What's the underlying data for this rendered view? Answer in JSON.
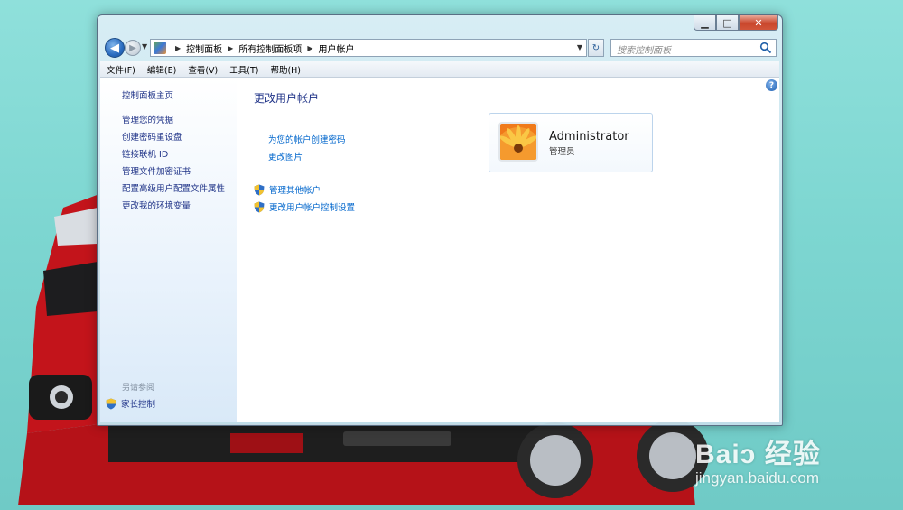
{
  "window": {
    "address_crumbs": [
      "控制面板",
      "所有控制面板项",
      "用户帐户"
    ],
    "search_placeholder": "搜索控制面板"
  },
  "menu": [
    "文件(F)",
    "编辑(E)",
    "查看(V)",
    "工具(T)",
    "帮助(H)"
  ],
  "sidebar": {
    "home": "控制面板主页",
    "links": [
      "管理您的凭据",
      "创建密码重设盘",
      "链接联机 ID",
      "管理文件加密证书",
      "配置高级用户配置文件属性",
      "更改我的环境变量"
    ],
    "see_also_label": "另请参阅",
    "see_also_link": "家长控制"
  },
  "main": {
    "title": "更改用户帐户",
    "links": [
      "为您的帐户创建密码",
      "更改图片"
    ],
    "shield_links": [
      "管理其他帐户",
      "更改用户帐户控制设置"
    ]
  },
  "account": {
    "name": "Administrator",
    "role": "管理员"
  },
  "watermark": {
    "brand": "Baiↄ 经验",
    "url": "jingyan.baidu.com"
  },
  "icons": {
    "back": "back-arrow-icon",
    "forward": "forward-arrow-icon",
    "refresh": "refresh-icon",
    "search": "search-icon",
    "help": "help-icon",
    "shield": "uac-shield-icon"
  },
  "colors": {
    "link": "#0066cc",
    "nav_link": "#1e3287",
    "desktop": "#7dd6d1"
  }
}
